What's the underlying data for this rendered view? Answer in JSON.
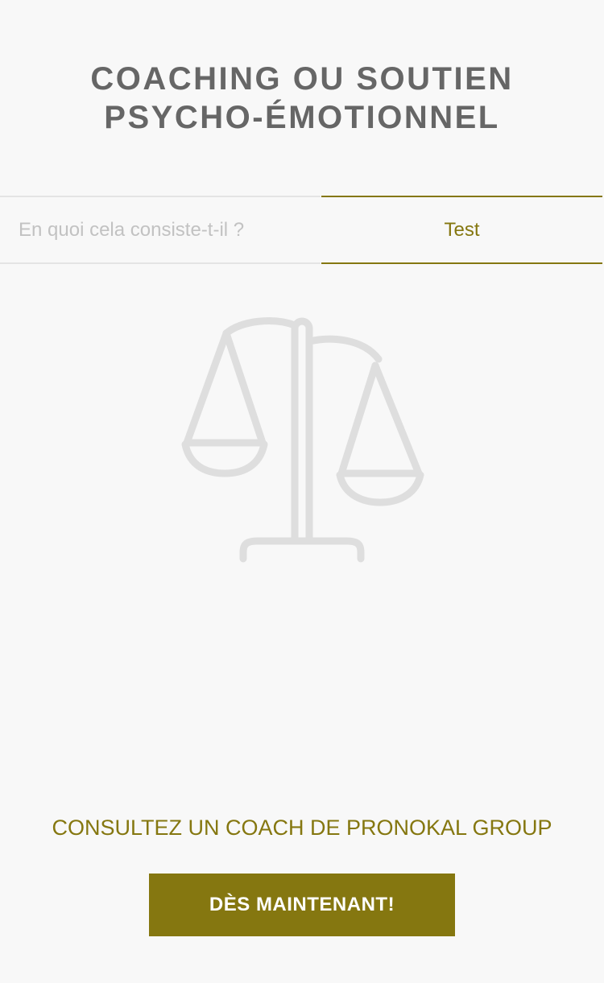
{
  "header": {
    "title_line1": "COACHING OU SOUTIEN",
    "title_line2": "PSYCHO-ÉMOTIONNEL"
  },
  "tabs": [
    {
      "label": "En quoi cela consiste-t-il ?",
      "active": false
    },
    {
      "label": "Test",
      "active": true
    }
  ],
  "illustration": {
    "icon": "scale-of-justice-icon",
    "color": "#dedede"
  },
  "cta": {
    "text": "CONSULTEZ UN COACH DE PRONOKAL GROUP",
    "button_label": "DÈS MAINTENANT!"
  },
  "colors": {
    "accent": "#857710",
    "title": "#666666",
    "inactive_tab_text": "#c2c2c2",
    "background": "#f8f8f8"
  }
}
